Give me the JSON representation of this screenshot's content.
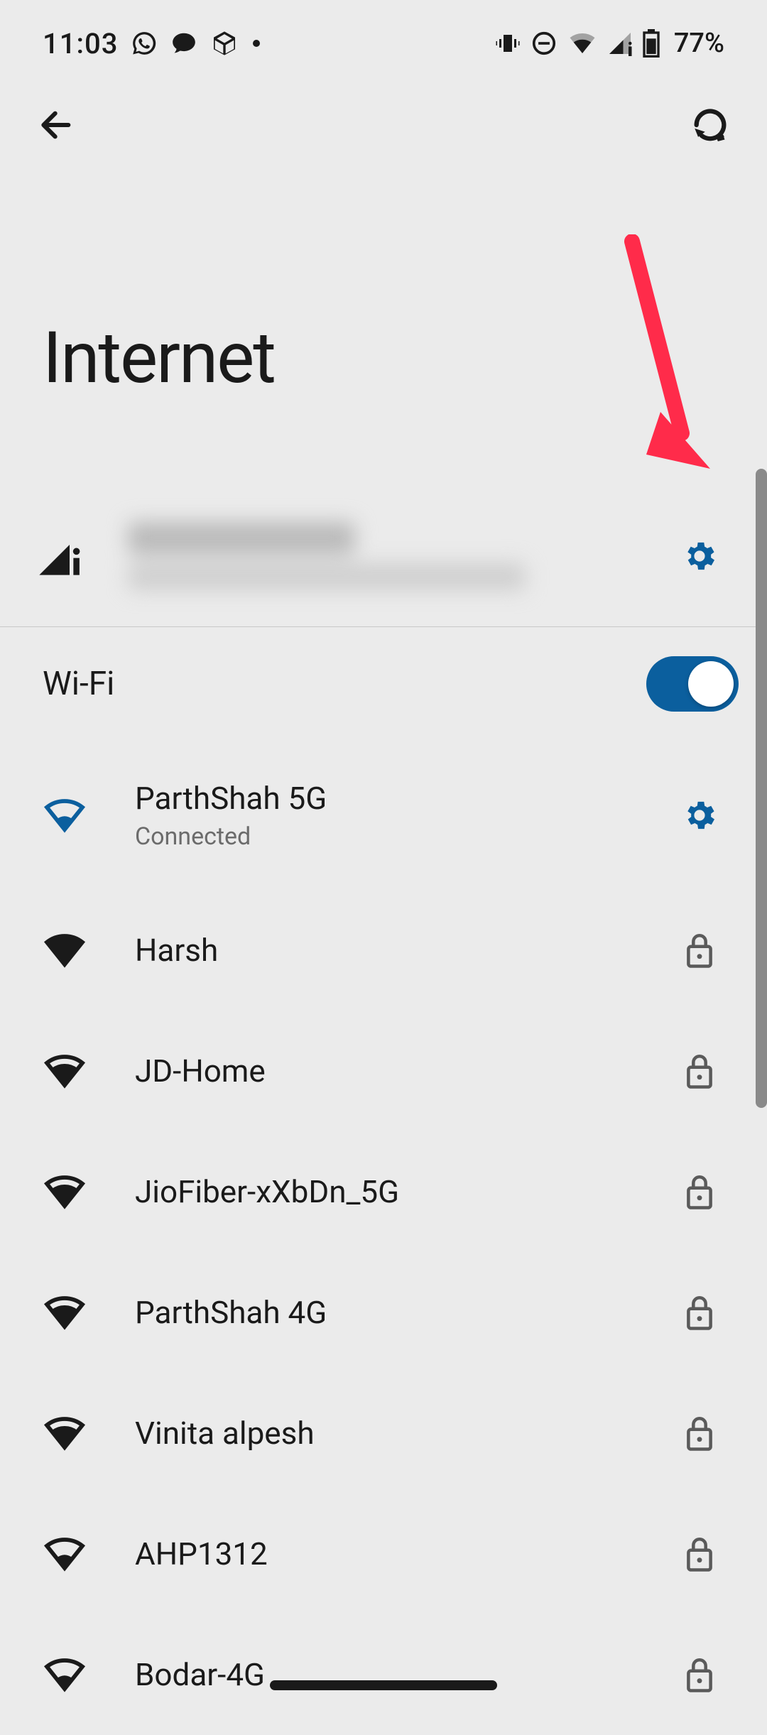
{
  "statusbar": {
    "time": "11:03",
    "battery": "77%"
  },
  "header": {
    "title": "Internet"
  },
  "wifi": {
    "label": "Wi-Fi",
    "enabled": true
  },
  "colors": {
    "accent": "#0b5f9e",
    "arrow": "#ff2b4a"
  },
  "connected": {
    "ssid": "ParthShah 5G",
    "status": "Connected"
  },
  "networks": [
    {
      "ssid": "Harsh",
      "locked": true
    },
    {
      "ssid": "JD-Home",
      "locked": true
    },
    {
      "ssid": "JioFiber-xXbDn_5G",
      "locked": true
    },
    {
      "ssid": "ParthShah 4G",
      "locked": true
    },
    {
      "ssid": "Vinita alpesh",
      "locked": true
    },
    {
      "ssid": "AHP1312",
      "locked": true
    },
    {
      "ssid": "Bodar-4G",
      "locked": true
    }
  ]
}
